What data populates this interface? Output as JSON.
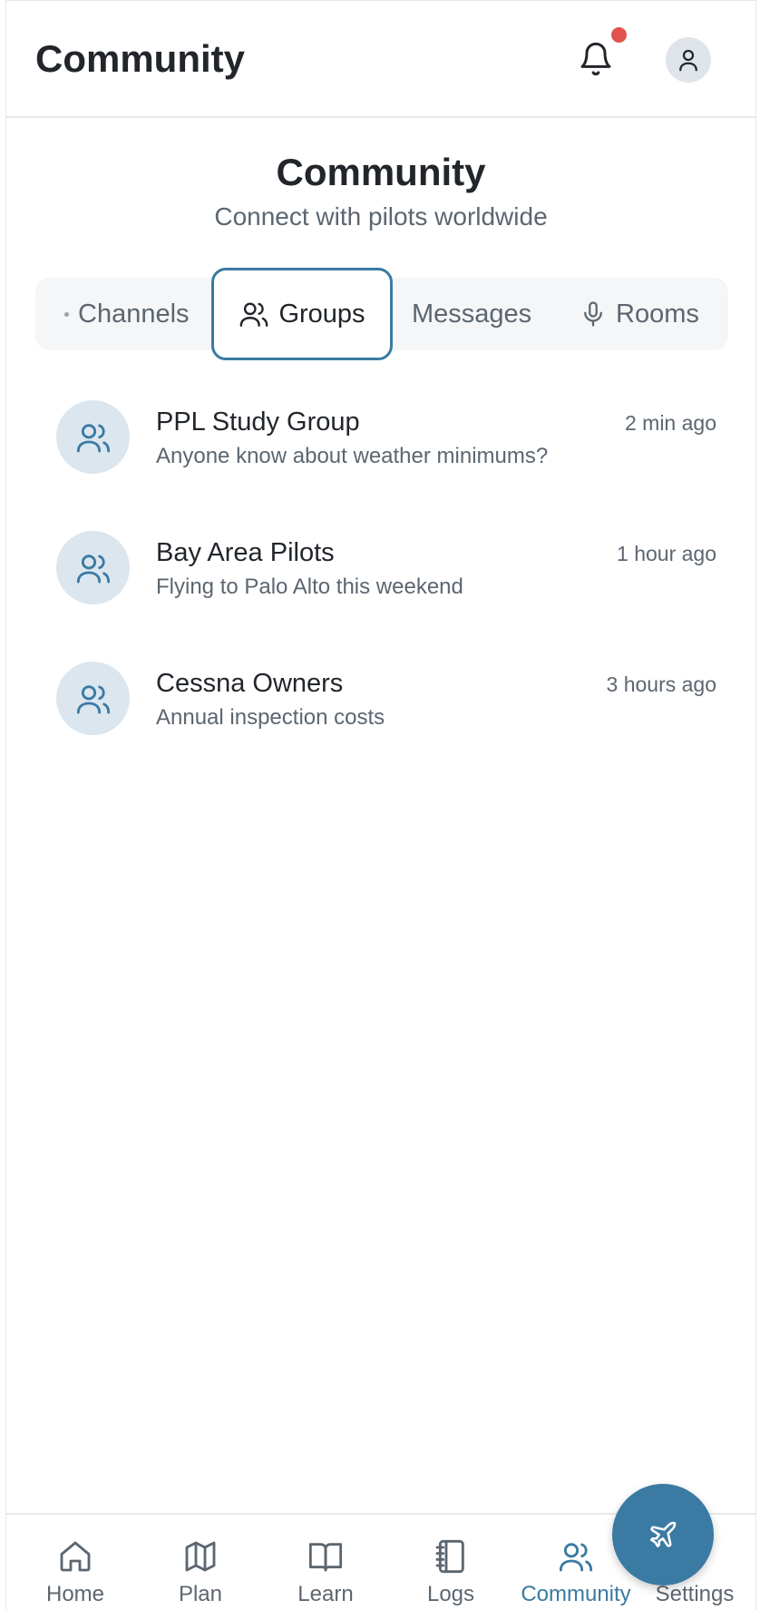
{
  "header": {
    "title": "Community"
  },
  "hero": {
    "title": "Community",
    "subtitle": "Connect with pilots worldwide"
  },
  "tabs": [
    {
      "label": "Channels",
      "icon": "dot-icon",
      "active": false
    },
    {
      "label": "Groups",
      "icon": "users-icon",
      "active": true
    },
    {
      "label": "Messages",
      "icon": "",
      "active": false
    },
    {
      "label": "Rooms",
      "icon": "microphone-icon",
      "active": false
    }
  ],
  "groups": [
    {
      "name": "PPL Study Group",
      "preview": "Anyone know about weather minimums?",
      "time": "2 min ago",
      "icon": "users-icon"
    },
    {
      "name": "Bay Area Pilots",
      "preview": "Flying to Palo Alto this weekend",
      "time": "1 hour ago",
      "icon": "users-icon"
    },
    {
      "name": "Cessna Owners",
      "preview": "Annual inspection costs",
      "time": "3 hours ago",
      "icon": "users-icon"
    }
  ],
  "bottom_nav": [
    {
      "label": "Home",
      "icon": "home-icon",
      "active": false
    },
    {
      "label": "Plan",
      "icon": "map-icon",
      "active": false
    },
    {
      "label": "Learn",
      "icon": "book-icon",
      "active": false
    },
    {
      "label": "Logs",
      "icon": "notebook-icon",
      "active": false
    },
    {
      "label": "Community",
      "icon": "users-icon",
      "active": true
    },
    {
      "label": "Settings",
      "icon": "gear-icon",
      "active": false
    }
  ],
  "colors": {
    "accent": "#3b7aa3",
    "notification_dot": "#e0524d",
    "avatar_bg": "#dbe6ef"
  }
}
